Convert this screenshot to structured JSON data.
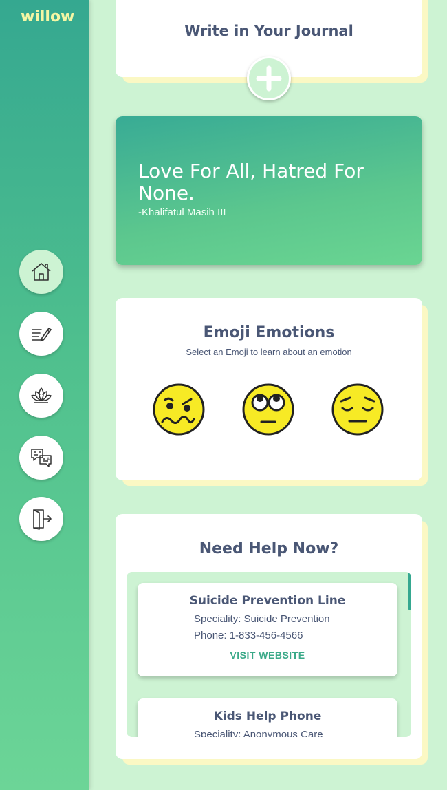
{
  "app": {
    "logo": "willow"
  },
  "colors": {
    "sidebar_top": "#35a890",
    "sidebar_bottom": "#6cd597",
    "background": "#cdf3d3",
    "heading": "#4a5775",
    "accent": "#3aa988",
    "card_offset": "#fbf8c4"
  },
  "nav": {
    "items": [
      {
        "icon": "home-icon",
        "active": true
      },
      {
        "icon": "journal-icon",
        "active": false
      },
      {
        "icon": "lotus-icon",
        "active": false
      },
      {
        "icon": "chat-translate-icon",
        "active": false
      },
      {
        "icon": "logout-icon",
        "active": false
      }
    ]
  },
  "journal": {
    "title": "Write in Your Journal",
    "add_icon": "plus-icon"
  },
  "quote": {
    "text": "Love For All, Hatred For None.",
    "author": "-Khalifatul Masih III"
  },
  "emotions": {
    "title": "Emoji Emotions",
    "subtitle": "Select an Emoji to learn about an emotion",
    "emojis": [
      {
        "icon": "woozy-face-icon"
      },
      {
        "icon": "rolling-eyes-face-icon"
      },
      {
        "icon": "pensive-face-icon"
      }
    ]
  },
  "help": {
    "title": "Need Help Now?",
    "resources": [
      {
        "name": "Suicide Prevention Line",
        "speciality": "Speciality: Suicide Prevention",
        "phone": "Phone: 1-833-456-4566",
        "link": "VISIT WEBSITE"
      },
      {
        "name": "Kids Help Phone",
        "speciality": "Speciality: Anonymous Care"
      }
    ]
  }
}
